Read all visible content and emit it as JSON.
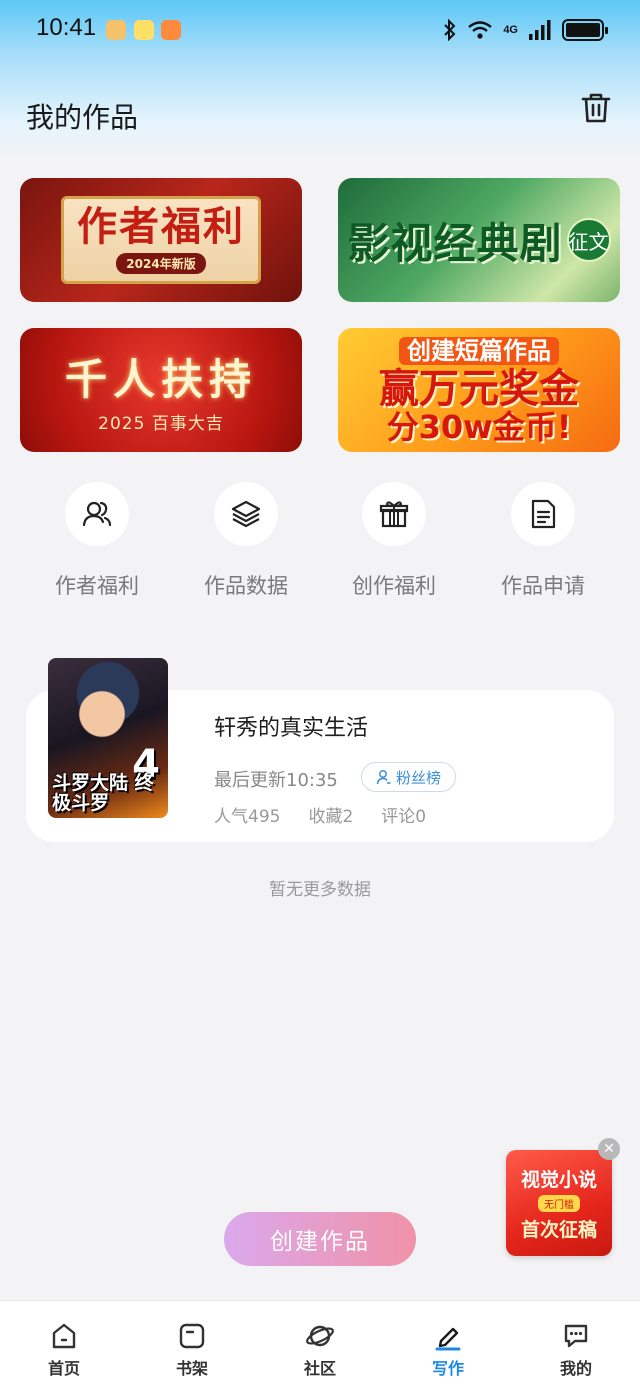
{
  "status_bar": {
    "time": "10:41",
    "network": "4G"
  },
  "header": {
    "title": "我的作品"
  },
  "banners": [
    {
      "title": "作者福利",
      "subtitle": "2024年新版"
    },
    {
      "title": "影视经典剧",
      "tag": "征文"
    },
    {
      "title": "千人扶持",
      "subtitle": "2025 百事大吉"
    },
    {
      "line1": "创建短篇作品",
      "line2": "赢万元奖金",
      "line3": "分30w金币!"
    }
  ],
  "quick_actions": [
    {
      "label": "作者福利",
      "icon": "users-icon"
    },
    {
      "label": "作品数据",
      "icon": "layers-icon"
    },
    {
      "label": "创作福利",
      "icon": "gift-icon"
    },
    {
      "label": "作品申请",
      "icon": "document-icon"
    }
  ],
  "work": {
    "title": "轩秀的真实生活",
    "updated": "最后更新10:35",
    "fans_label": "粉丝榜",
    "popularity": "人气495",
    "favorites": "收藏2",
    "comments": "评论0",
    "cover_text": "斗罗大陆 终极斗罗",
    "cover_number": "4"
  },
  "no_more": "暂无更多数据",
  "float_ad": {
    "line1": "视觉小说",
    "tag": "无门槛",
    "line2": "首次征稿"
  },
  "create_button": "创建作品",
  "tabs": [
    {
      "label": "首页",
      "icon": "home-icon"
    },
    {
      "label": "书架",
      "icon": "bookshelf-icon"
    },
    {
      "label": "社区",
      "icon": "planet-icon"
    },
    {
      "label": "写作",
      "icon": "pen-icon",
      "active": true
    },
    {
      "label": "我的",
      "icon": "chat-bubble-icon"
    }
  ],
  "colors": {
    "accent": "#1e88e5",
    "create_gradient_start": "#d9a2ec",
    "create_gradient_end": "#f08aa0"
  }
}
